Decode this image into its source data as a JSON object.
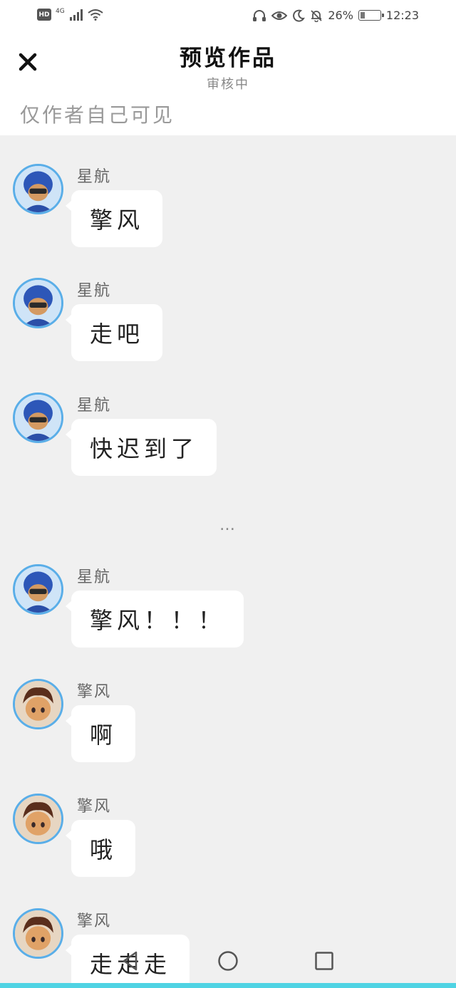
{
  "status_bar": {
    "hd": "HD",
    "network": "4G",
    "battery": "26%",
    "battery_level": 0.26,
    "time": "12:23",
    "icons": [
      "headphones-icon",
      "eye-icon",
      "moon-icon",
      "bell-off-icon"
    ]
  },
  "header": {
    "title": "预览作品",
    "subtitle": "审核中",
    "visibility_note": "仅作者自己可见",
    "close_icon": "close-icon"
  },
  "messages": [
    {
      "name": "星航",
      "text": "擎风",
      "avatar": "blue-helmet-character-avatar"
    },
    {
      "name": "星航",
      "text": "走吧",
      "avatar": "blue-helmet-character-avatar"
    },
    {
      "name": "星航",
      "text": "快迟到了",
      "avatar": "blue-helmet-character-avatar"
    },
    {
      "name": "星航",
      "text": "擎风！！！",
      "avatar": "blue-helmet-character-avatar"
    },
    {
      "name": "擎风",
      "text": "啊",
      "avatar": "brown-hair-character-avatar"
    },
    {
      "name": "擎风",
      "text": "哦",
      "avatar": "brown-hair-character-avatar"
    },
    {
      "name": "擎风",
      "text": "走走走",
      "avatar": "brown-hair-character-avatar"
    }
  ],
  "divider": "…",
  "nav": {
    "back_icon": "triangle-back-icon",
    "home_icon": "circle-home-icon",
    "recent_icon": "square-recent-icon"
  },
  "colors": {
    "avatar_ring": "#5aaee8",
    "bottom_strip": "#4fd3e3",
    "chat_background": "#f0f0f0"
  }
}
